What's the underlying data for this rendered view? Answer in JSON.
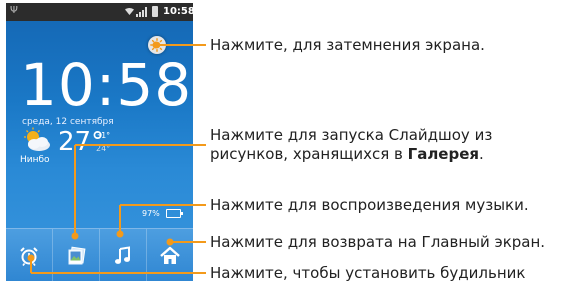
{
  "statusbar": {
    "time": "10:58"
  },
  "widget": {
    "clock": "10:58",
    "date": "среда, 12 сентября",
    "temperature": "27°",
    "temp_high": "31°",
    "temp_low": "24°",
    "city": "Нинбо",
    "battery": "97%"
  },
  "dock": [
    "alarm-clock-icon",
    "slideshow-icon",
    "music-icon",
    "home-icon"
  ],
  "callouts": {
    "dim": "Нажмите, для затемнения экрана.",
    "slideshow_line1": "Нажмите для запуска Слайдшоу из",
    "slideshow_line2": "рисунков, хранящихся в ",
    "slideshow_bold": "Галерея",
    "slideshow_end": ".",
    "music": "Нажмите для воспроизведения музыки.",
    "home": "Нажмите для возврата на Главный экран.",
    "alarm": "Нажмите, чтобы установить будильник"
  },
  "colors": {
    "accent": "#f39a1b",
    "screen_bg": "#1a78c6"
  }
}
